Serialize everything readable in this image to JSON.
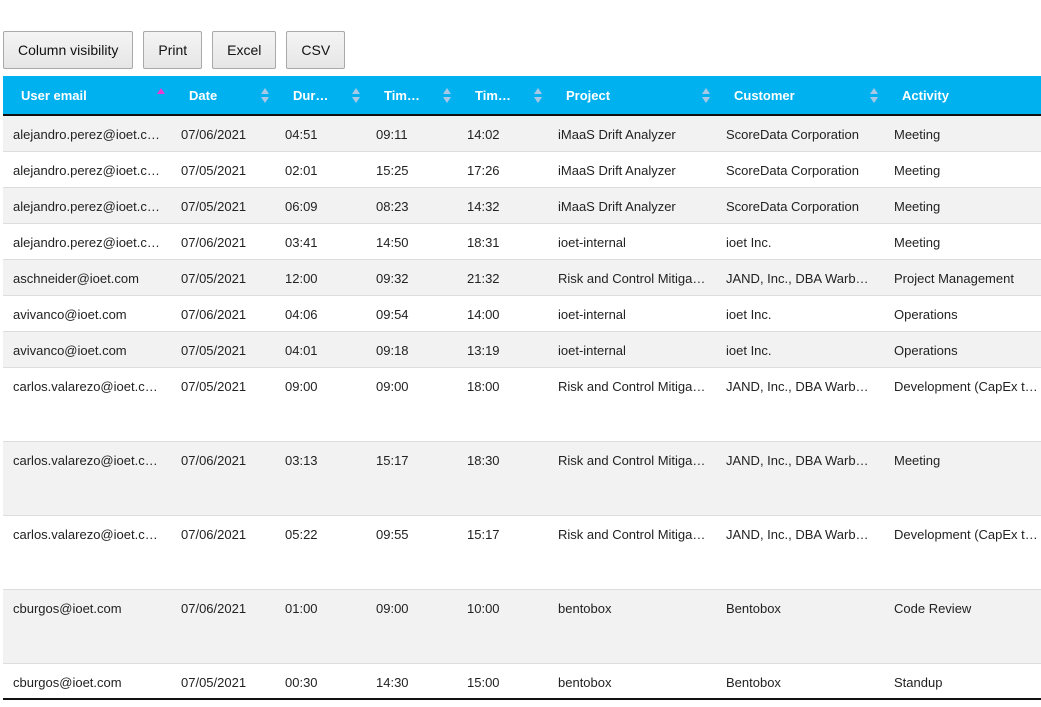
{
  "toolbar": {
    "buttons": [
      "Column visibility",
      "Print",
      "Excel",
      "CSV"
    ]
  },
  "colors": {
    "header_bg": "#00b1f0",
    "header_text": "#ffffff",
    "row_odd": "#f2f2f2",
    "row_even": "#ffffff",
    "sort_active": "#e93bd0",
    "sort_inactive": "#a9c8e6"
  },
  "table": {
    "columns": [
      {
        "label": "User email",
        "sort": "asc"
      },
      {
        "label": "Date",
        "sort": "none"
      },
      {
        "label": "Durati…",
        "sort": "none"
      },
      {
        "label": "Time in",
        "sort": "none"
      },
      {
        "label": "Time out",
        "sort": "none"
      },
      {
        "label": "Project",
        "sort": "none"
      },
      {
        "label": "Customer",
        "sort": "none"
      },
      {
        "label": "Activity",
        "sort": "none"
      }
    ],
    "rows": [
      [
        "alejandro.perez@ioet.c…",
        "07/06/2021",
        "04:51",
        "09:11",
        "14:02",
        "iMaaS Drift Analyzer",
        "ScoreData Corporation",
        "Meeting"
      ],
      [
        "alejandro.perez@ioet.c…",
        "07/05/2021",
        "02:01",
        "15:25",
        "17:26",
        "iMaaS Drift Analyzer",
        "ScoreData Corporation",
        "Meeting"
      ],
      [
        "alejandro.perez@ioet.c…",
        "07/05/2021",
        "06:09",
        "08:23",
        "14:32",
        "iMaaS Drift Analyzer",
        "ScoreData Corporation",
        "Meeting"
      ],
      [
        "alejandro.perez@ioet.c…",
        "07/06/2021",
        "03:41",
        "14:50",
        "18:31",
        "ioet-internal",
        "ioet Inc.",
        "Meeting"
      ],
      [
        "aschneider@ioet.com",
        "07/05/2021",
        "12:00",
        "09:32",
        "21:32",
        "Risk and Control Mitiga…",
        "JAND, Inc., DBA Warb…",
        "Project Management"
      ],
      [
        "avivanco@ioet.com",
        "07/06/2021",
        "04:06",
        "09:54",
        "14:00",
        "ioet-internal",
        "ioet Inc.",
        "Operations"
      ],
      [
        "avivanco@ioet.com",
        "07/05/2021",
        "04:01",
        "09:18",
        "13:19",
        "ioet-internal",
        "ioet Inc.",
        "Operations"
      ],
      [
        "carlos.valarezo@ioet.c…",
        "07/05/2021",
        "09:00",
        "09:00",
        "18:00",
        "Risk and Control Mitiga…",
        "JAND, Inc., DBA Warb…",
        "Development (CapEx t…"
      ],
      [
        "carlos.valarezo@ioet.c…",
        "07/06/2021",
        "03:13",
        "15:17",
        "18:30",
        "Risk and Control Mitiga…",
        "JAND, Inc., DBA Warb…",
        "Meeting"
      ],
      [
        "carlos.valarezo@ioet.c…",
        "07/06/2021",
        "05:22",
        "09:55",
        "15:17",
        "Risk and Control Mitiga…",
        "JAND, Inc., DBA Warb…",
        "Development (CapEx t…"
      ],
      [
        "cburgos@ioet.com",
        "07/06/2021",
        "01:00",
        "09:00",
        "10:00",
        "bentobox",
        "Bentobox",
        "Code Review"
      ],
      [
        "cburgos@ioet.com",
        "07/05/2021",
        "00:30",
        "14:30",
        "15:00",
        "bentobox",
        "Bentobox",
        "Standup"
      ]
    ]
  }
}
